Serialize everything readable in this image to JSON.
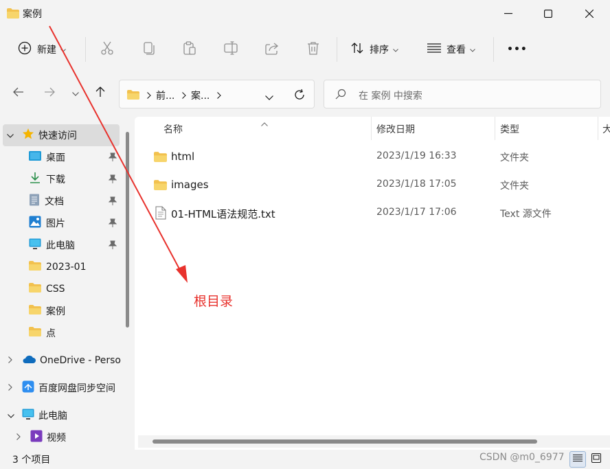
{
  "window": {
    "title": "案例"
  },
  "toolbar": {
    "new_label": "新建",
    "sort_label": "排序",
    "view_label": "查看",
    "more_label": "•••"
  },
  "address": {
    "crumbs": [
      "前...",
      "案..."
    ]
  },
  "search": {
    "placeholder": "在 案例 中搜索"
  },
  "nav": {
    "quick_access": "快速访问",
    "items": [
      {
        "label": "桌面",
        "icon": "desktop-icon",
        "pinned": true
      },
      {
        "label": "下载",
        "icon": "download-icon",
        "pinned": true
      },
      {
        "label": "文档",
        "icon": "document-icon",
        "pinned": true
      },
      {
        "label": "图片",
        "icon": "picture-icon",
        "pinned": true
      },
      {
        "label": "此电脑",
        "icon": "computer-icon",
        "pinned": true
      },
      {
        "label": "2023-01",
        "icon": "folder-icon",
        "pinned": false
      },
      {
        "label": "CSS",
        "icon": "folder-icon",
        "pinned": false
      },
      {
        "label": "案例",
        "icon": "folder-icon",
        "pinned": false
      },
      {
        "label": "点",
        "icon": "folder-icon",
        "pinned": false
      }
    ],
    "onedrive": "OneDrive - Perso",
    "baidu": "百度网盘同步空间",
    "this_pc": "此电脑",
    "video": "视频"
  },
  "columns": {
    "name": "名称",
    "modified": "修改日期",
    "type": "类型",
    "size": "大"
  },
  "files": [
    {
      "name": "html",
      "modified": "2023/1/19 16:33",
      "type": "文件夹",
      "icon": "folder-icon"
    },
    {
      "name": "images",
      "modified": "2023/1/18 17:05",
      "type": "文件夹",
      "icon": "folder-icon"
    },
    {
      "name": "01-HTML语法规范.txt",
      "modified": "2023/1/17 17:06",
      "type": "Text 源文件",
      "icon": "text-file-icon"
    }
  ],
  "status": {
    "count": "3 个项目"
  },
  "watermark": "CSDN @m0_6977",
  "annotation": {
    "label": "根目录",
    "color": "#e8322d"
  },
  "colors": {
    "folder": "#f2c14e",
    "accent": "#0067c0",
    "selected": "#dcdcdc"
  }
}
